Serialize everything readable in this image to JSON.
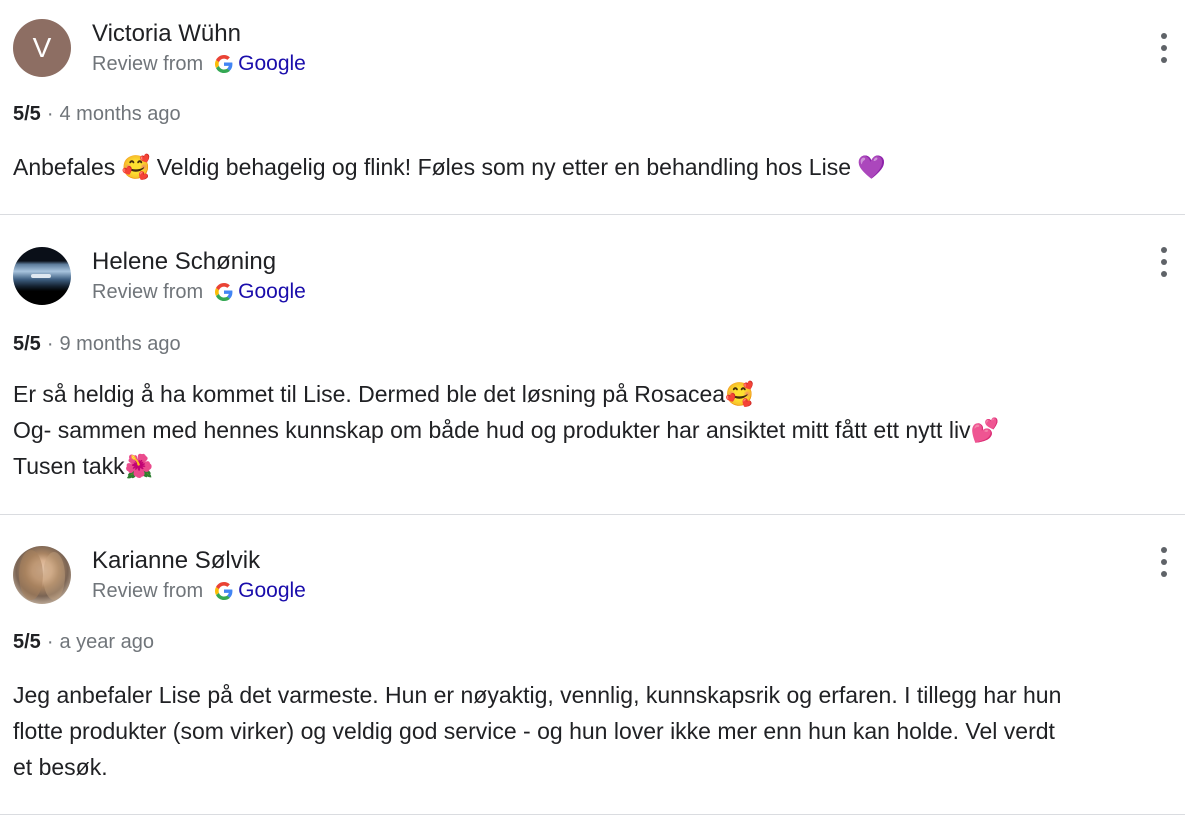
{
  "reviews": [
    {
      "avatar_letter": "V",
      "avatar_color": "#8d6e63",
      "name": "Victoria Wühn",
      "source_label": "Review from",
      "source_name": "Google",
      "score": "5/5",
      "separator": "·",
      "time": "4 months ago",
      "text_lines": [
        "Anbefales 🥰 Veldig behagelig og flink! Føles som ny etter en behandling hos Lise 💜"
      ]
    },
    {
      "avatar_letter": "",
      "name": "Helene Schøning",
      "source_label": "Review from",
      "source_name": "Google",
      "score": "5/5",
      "separator": "·",
      "time": "9 months ago",
      "text_lines": [
        "Er så heldig å ha kommet til Lise. Dermed ble det løsning på Rosacea🥰",
        "Og- sammen med hennes kunnskap om både hud og produkter har ansiktet mitt fått ett nytt liv💕",
        "Tusen takk🌺"
      ]
    },
    {
      "avatar_letter": "",
      "name": "Karianne Sølvik",
      "source_label": "Review from",
      "source_name": "Google",
      "score": "5/5",
      "separator": "·",
      "time": "a year ago",
      "text_lines": [
        "Jeg anbefaler Lise på det varmeste. Hun er nøyaktig, vennlig, kunnskapsrik og erfaren. I tillegg har hun",
        "flotte produkter (som virker) og veldig god service - og hun lover ikke mer enn hun kan holde. Vel verdt",
        "et besøk."
      ]
    }
  ],
  "icons": {
    "more": "more-vert-icon",
    "google": "google-g-icon"
  },
  "colors": {
    "link": "#1a0dab",
    "muted": "#70757a",
    "divider": "#dadce0"
  }
}
